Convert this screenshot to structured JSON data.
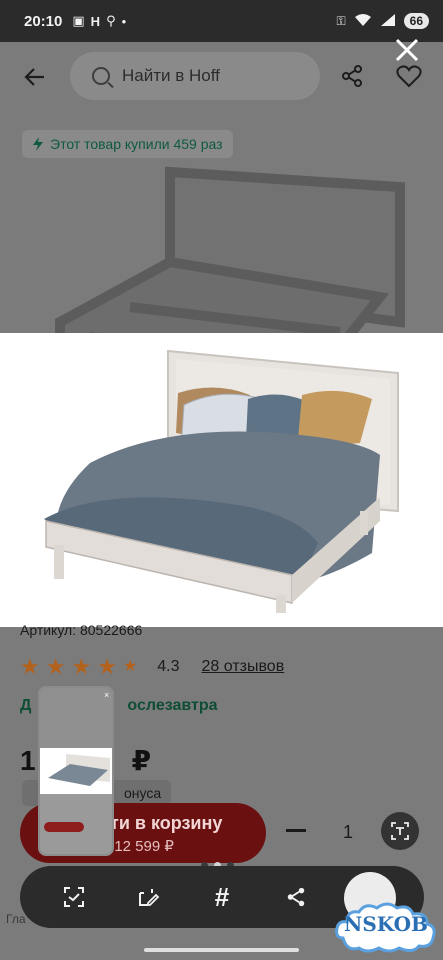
{
  "status_bar": {
    "time": "20:10",
    "battery": "66"
  },
  "header": {
    "search_placeholder": "Найти в Hoff"
  },
  "badge": {
    "bought_text": "Этот товар купили 459 раз"
  },
  "product": {
    "sku_text": "Артикул: 80522666",
    "rating": {
      "stars_filled": 4.3,
      "value": "4.3",
      "reviews": "28 отзывов"
    },
    "delivery_text": "Доставка послезавтра",
    "delivery_visible": "Д",
    "delivery_visible_tail": "ослезавтра",
    "price_prefix": "1",
    "currency": "₽",
    "bonus_tail": "онуса"
  },
  "actions": {
    "cart_label": "ти в корзину",
    "cart_sub": "/ 12 599 ₽",
    "qty_value": "1"
  },
  "toolbar": {
    "icons": [
      "scan-icon",
      "edit-screenshot-icon",
      "hashtag-icon",
      "share-icon",
      "lens-icon"
    ]
  },
  "watermark": {
    "text": "NSKOB"
  },
  "behind_toolbar_text": "Гла"
}
